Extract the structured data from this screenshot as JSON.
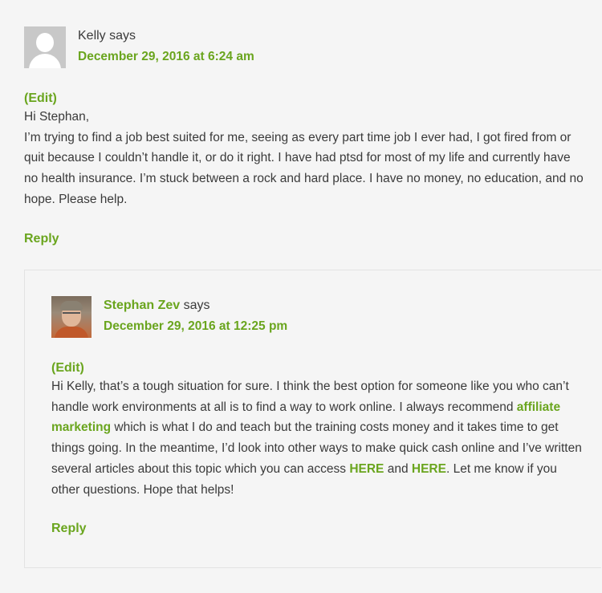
{
  "comment1": {
    "author": "Kelly",
    "says": "says",
    "date": "December 29, 2016 at 6:24 am",
    "edit": "(Edit)",
    "greeting": "Hi Stephan,",
    "body": "I’m trying to find a job best suited for me, seeing as every part time job I ever had, I got fired from or quit because I couldn’t handle it, or do it right. I have had ptsd for most of my life and currently have no health insurance. I’m stuck between a rock and hard place. I have no money, no education, and no hope. Please help.",
    "reply": "Reply"
  },
  "comment2": {
    "author": "Stephan Zev",
    "says": "says",
    "date": "December 29, 2016 at 12:25 pm",
    "edit": "(Edit)",
    "text_part1": "Hi Kelly, that’s a tough situation for sure. I think the best option for someone like you who can’t handle work environments at all is to find a way to work online. I always recommend ",
    "link1": "affiliate marketing",
    "text_part2": " which is what I do and teach but the training costs money and it takes time to get things going. In the meantime, I’d look into other ways to make quick cash online and I’ve written several articles about this topic which you can access ",
    "link2": "HERE",
    "text_part3": " and ",
    "link3": "HERE",
    "text_part4": ". Let me know if you other questions. Hope that helps!",
    "reply": "Reply"
  },
  "colors": {
    "link": "#6aa51e",
    "text": "#3a3a3a",
    "background": "#f5f5f5"
  },
  "icons": {
    "default_avatar": "default-avatar-icon",
    "author_photo": "author-avatar"
  }
}
